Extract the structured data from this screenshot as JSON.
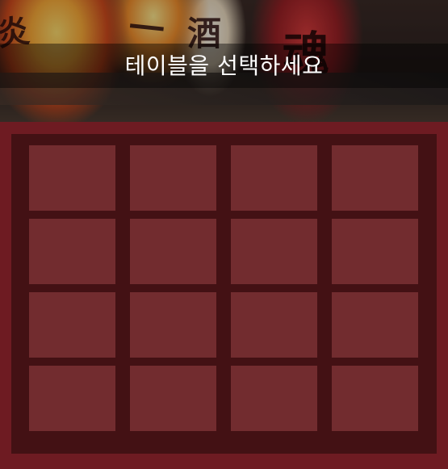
{
  "header": {
    "title": "테이블을 선택하세요",
    "background_image": "izakaya-lanterns-photo",
    "lantern_glyphs": [
      "炎",
      "一",
      "酒",
      "魂"
    ]
  },
  "tables": {
    "rows": 4,
    "columns": 4,
    "cell_count": 16,
    "cell_color": "#722c2f",
    "board_color": "#431114",
    "page_background": "#6e1b22"
  }
}
